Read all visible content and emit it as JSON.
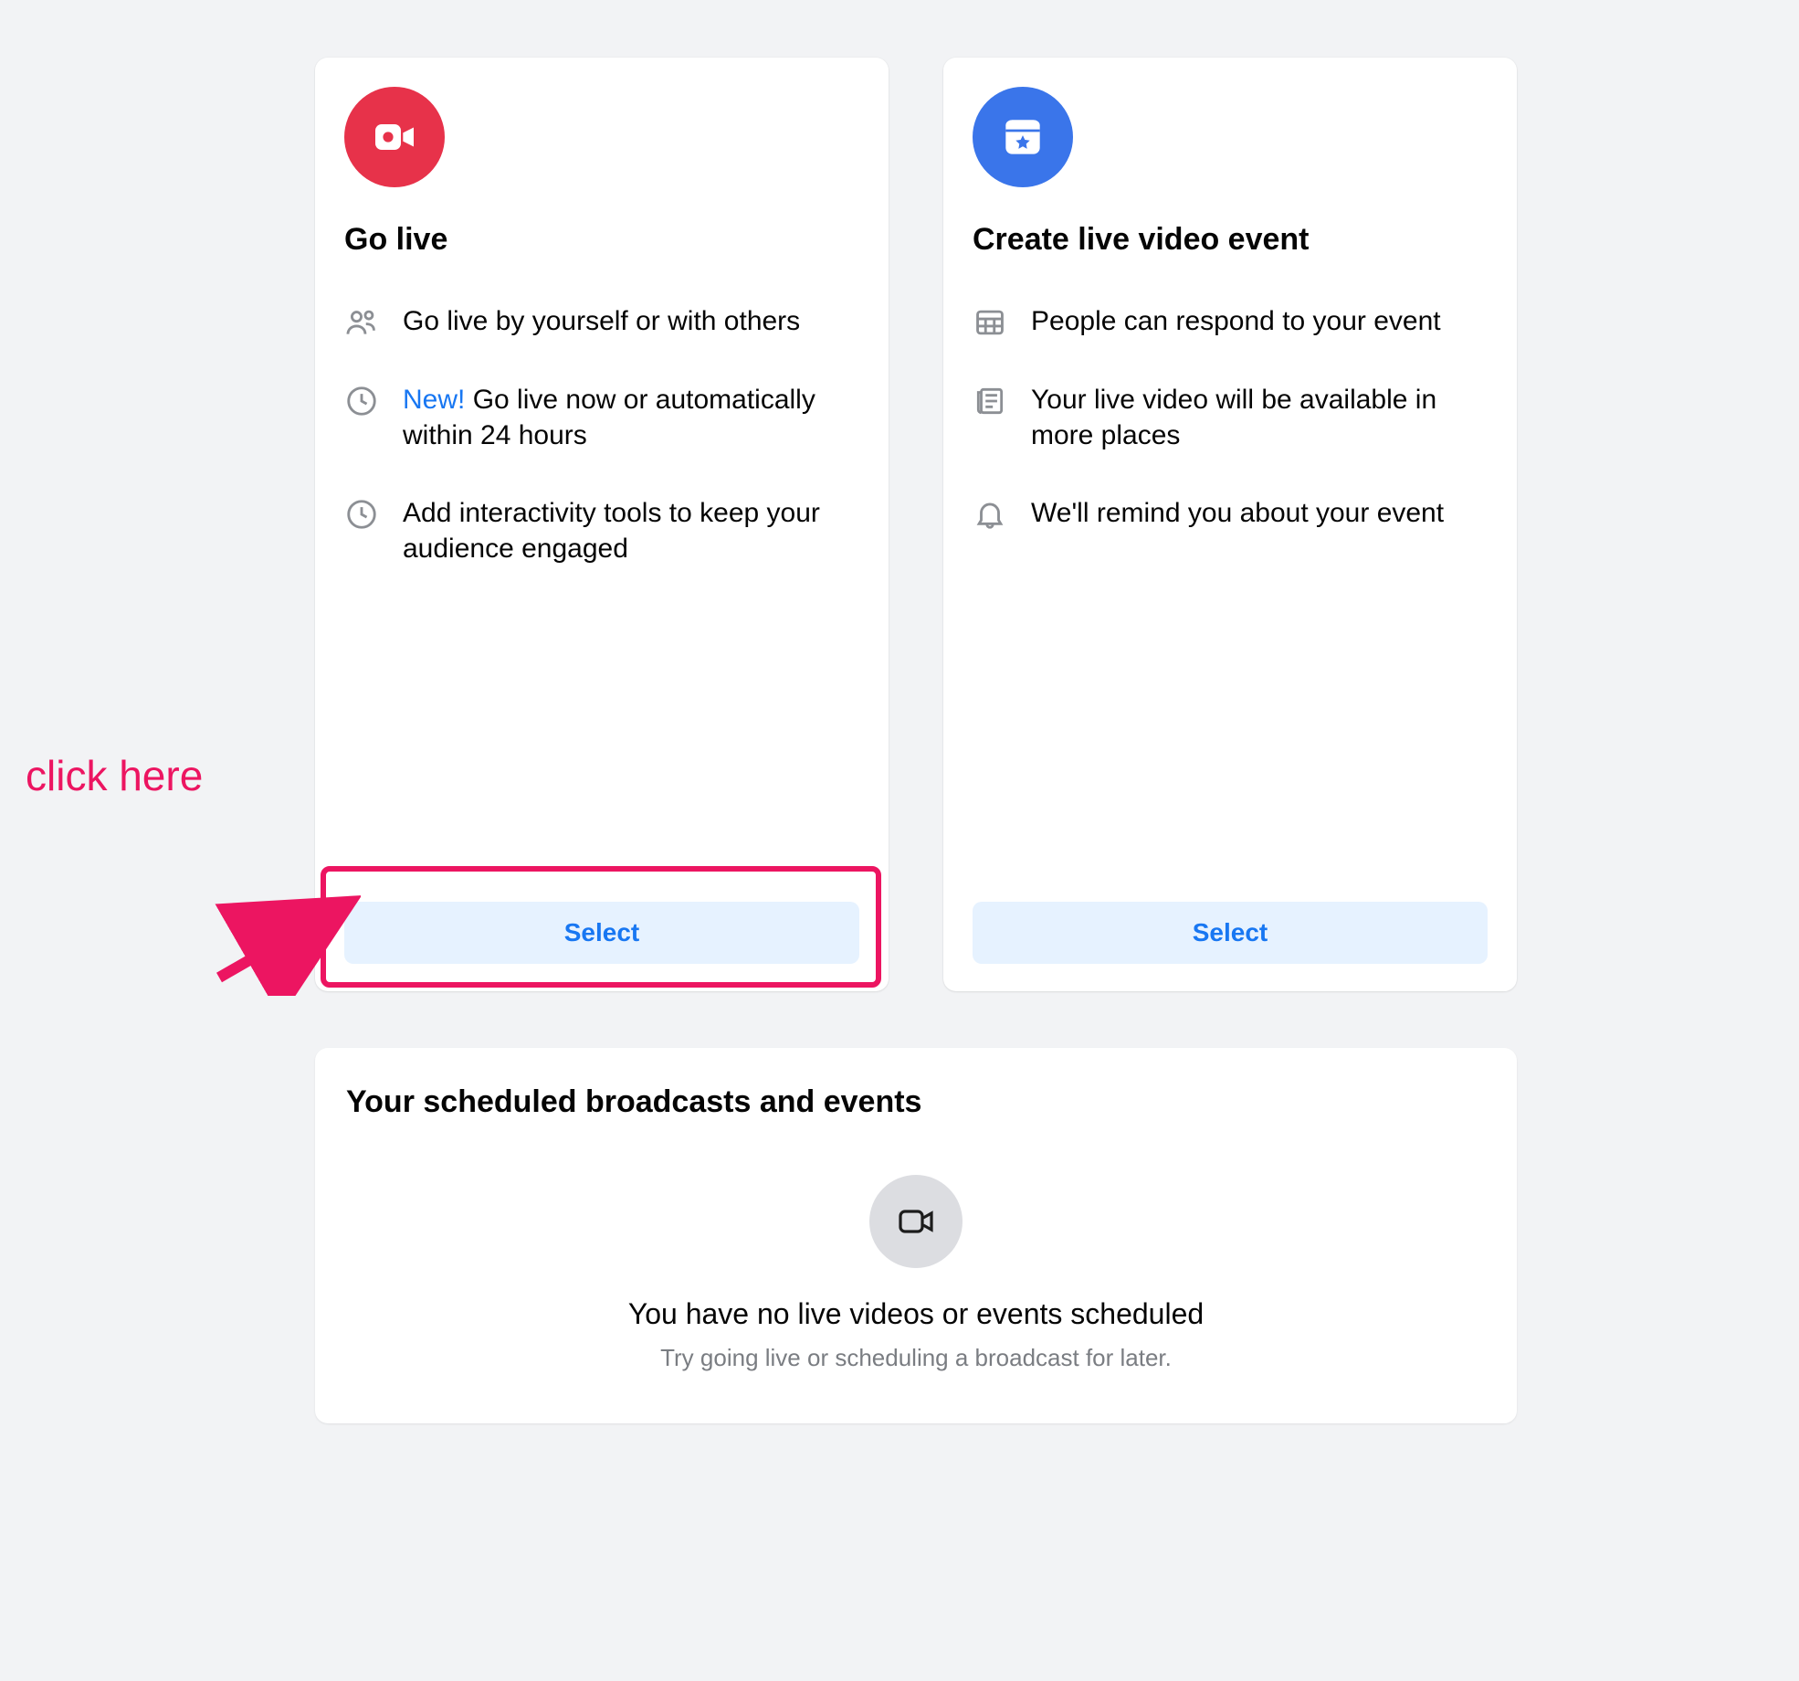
{
  "annotation": {
    "label": "click here"
  },
  "cards": {
    "go_live": {
      "title": "Go live",
      "features": [
        {
          "text": "Go live by yourself or with others"
        },
        {
          "prefix": "New!",
          "text": "Go live now or automatically within 24 hours"
        },
        {
          "text": "Add interactivity tools to keep your audience engaged"
        }
      ],
      "select_label": "Select"
    },
    "create_event": {
      "title": "Create live video event",
      "features": [
        {
          "text": "People can respond to your event"
        },
        {
          "text": "Your live video will be available in more places"
        },
        {
          "text": "We'll remind you about your event"
        }
      ],
      "select_label": "Select"
    }
  },
  "scheduled": {
    "title": "Your scheduled broadcasts and events",
    "empty_title": "You have no live videos or events scheduled",
    "empty_sub": "Try going live or scheduling a broadcast for later."
  }
}
